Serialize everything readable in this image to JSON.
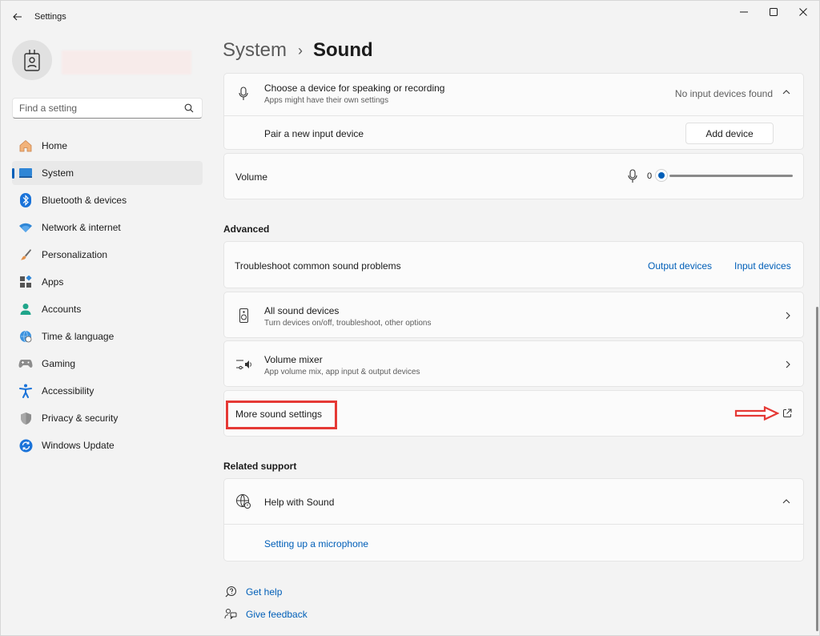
{
  "titlebar": {
    "app_title": "Settings",
    "back_icon": "back-arrow-icon",
    "controls": [
      "minimize",
      "maximize",
      "close"
    ]
  },
  "sidebar": {
    "search_placeholder": "Find a setting",
    "items": [
      {
        "label": "Home",
        "icon": "home-icon",
        "active": false
      },
      {
        "label": "System",
        "icon": "system-icon",
        "active": true
      },
      {
        "label": "Bluetooth & devices",
        "icon": "bluetooth-icon",
        "active": false
      },
      {
        "label": "Network & internet",
        "icon": "network-icon",
        "active": false
      },
      {
        "label": "Personalization",
        "icon": "brush-icon",
        "active": false
      },
      {
        "label": "Apps",
        "icon": "apps-icon",
        "active": false
      },
      {
        "label": "Accounts",
        "icon": "accounts-icon",
        "active": false
      },
      {
        "label": "Time & language",
        "icon": "globe-clock-icon",
        "active": false
      },
      {
        "label": "Gaming",
        "icon": "gamepad-icon",
        "active": false
      },
      {
        "label": "Accessibility",
        "icon": "accessibility-icon",
        "active": false
      },
      {
        "label": "Privacy & security",
        "icon": "shield-icon",
        "active": false
      },
      {
        "label": "Windows Update",
        "icon": "update-icon",
        "active": false
      }
    ]
  },
  "breadcrumb": {
    "parent": "System",
    "separator": "›",
    "current": "Sound"
  },
  "input": {
    "choose_title": "Choose a device for speaking or recording",
    "choose_sub": "Apps might have their own settings",
    "status": "No input devices found",
    "pair_label": "Pair a new input device",
    "add_device": "Add device",
    "volume_label": "Volume",
    "volume_value": "0"
  },
  "advanced": {
    "heading": "Advanced",
    "troubleshoot_label": "Troubleshoot common sound problems",
    "output_devices": "Output devices",
    "input_devices": "Input devices",
    "all_devices_title": "All sound devices",
    "all_devices_sub": "Turn devices on/off, troubleshoot, other options",
    "mixer_title": "Volume mixer",
    "mixer_sub": "App volume mix, app input & output devices",
    "more_settings": "More sound settings"
  },
  "support": {
    "heading": "Related support",
    "help_title": "Help with Sound",
    "help_link": "Setting up a microphone"
  },
  "footer": {
    "get_help": "Get help",
    "give_feedback": "Give feedback"
  },
  "colors": {
    "accent": "#005fb8",
    "highlight": "#e53935",
    "background": "#f3f3f3",
    "card": "#fbfbfb"
  }
}
